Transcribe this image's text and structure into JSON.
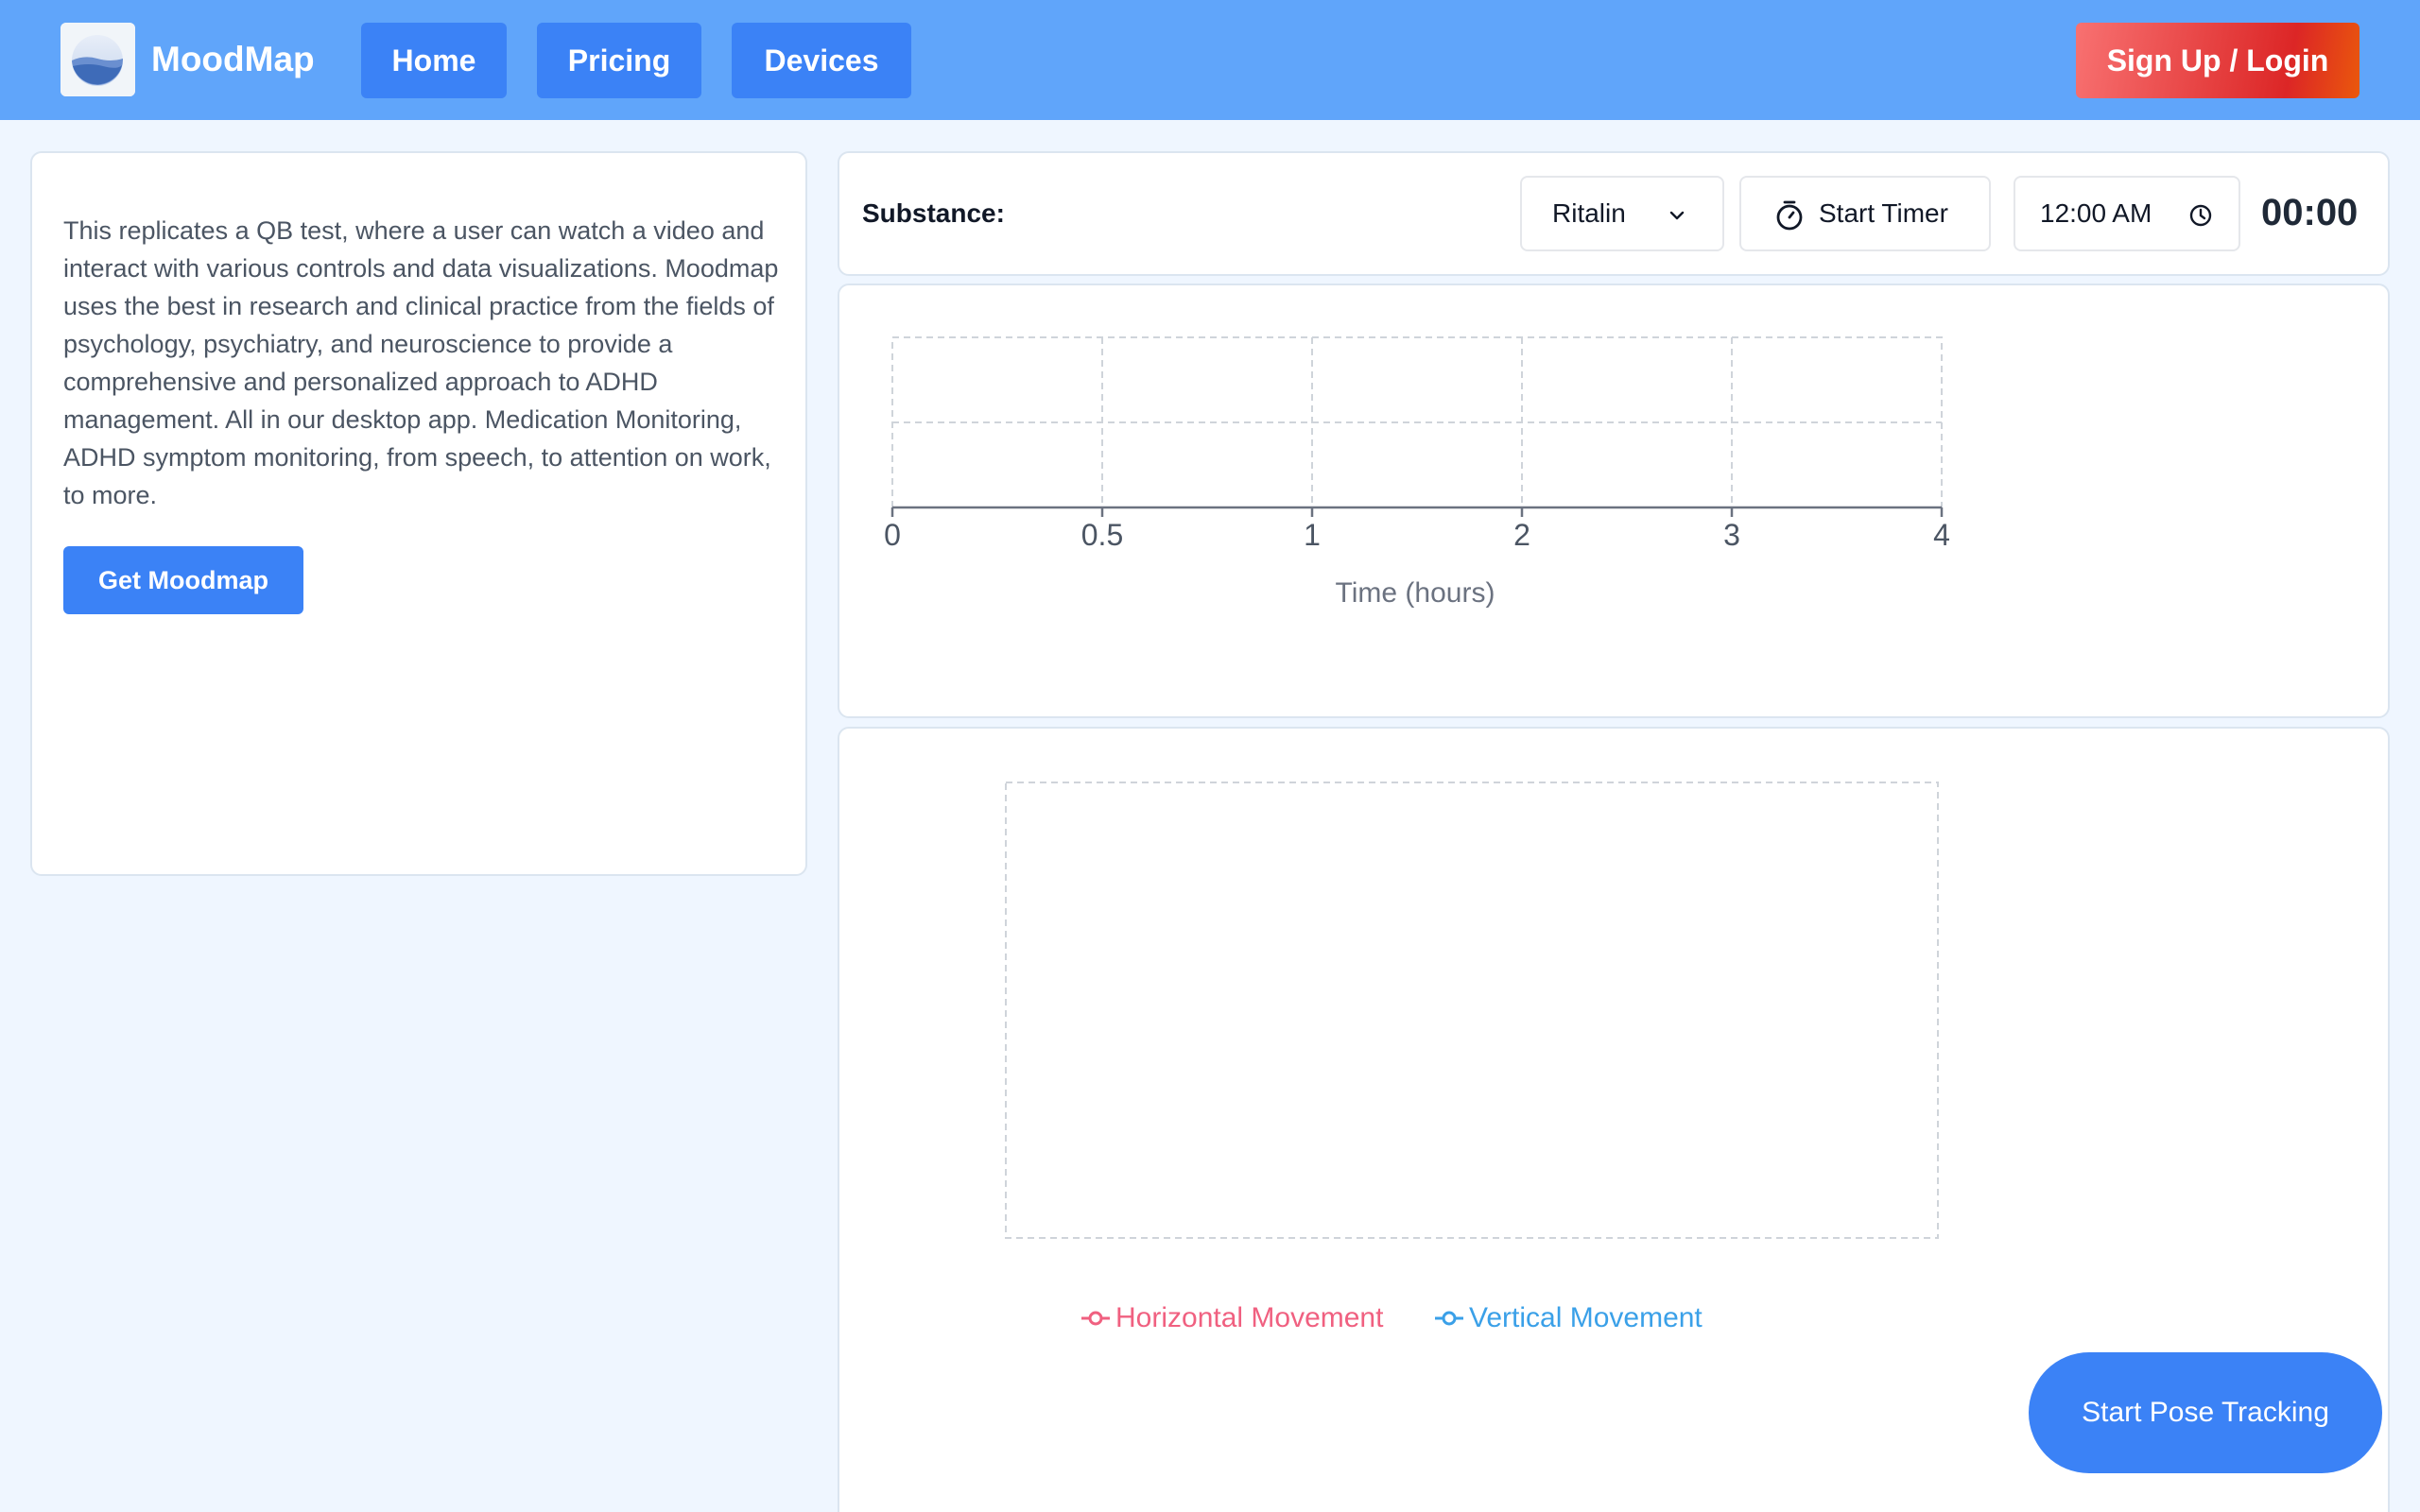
{
  "app": {
    "brand": "MoodMap",
    "logo_icon": "landscape-logo-icon"
  },
  "nav": {
    "items": [
      {
        "label": "Home"
      },
      {
        "label": "Pricing"
      },
      {
        "label": "Devices"
      }
    ],
    "signup_label": "Sign Up / Login"
  },
  "info": {
    "text": "This replicates a QB test, where a user can watch a video and interact with various controls and data visualizations. Moodmap uses the best in research and clinical practice from the fields of psychology, psychiatry, and neuroscience to provide a comprehensive and personalized approach to ADHD management. All in our desktop app. Medication Monitoring, ADHD symptom monitoring, from speech, to attention on work, to more.",
    "cta_label": "Get Moodmap"
  },
  "controls": {
    "substance_label": "Substance:",
    "substance_value": "Ritalin",
    "timer_label": "Start Timer",
    "time_value": "12:00 AM",
    "elapsed": "00:00"
  },
  "chart_data": [
    {
      "type": "line",
      "x_ticks": [
        "0",
        "0.5",
        "1",
        "2",
        "3",
        "4"
      ],
      "xlabel": "Time (hours)",
      "series": [],
      "grid": true
    },
    {
      "type": "line",
      "series": [
        {
          "name": "Horizontal Movement",
          "color": "#f06080",
          "values": []
        },
        {
          "name": "Vertical Movement",
          "color": "#3aa0e8",
          "values": []
        }
      ],
      "grid": true,
      "legend": "bottom"
    }
  ],
  "pose": {
    "label": "Start Pose Tracking"
  },
  "colors": {
    "header": "#60a5fa",
    "primary": "#3b82f6",
    "signup": "#dc2626"
  }
}
